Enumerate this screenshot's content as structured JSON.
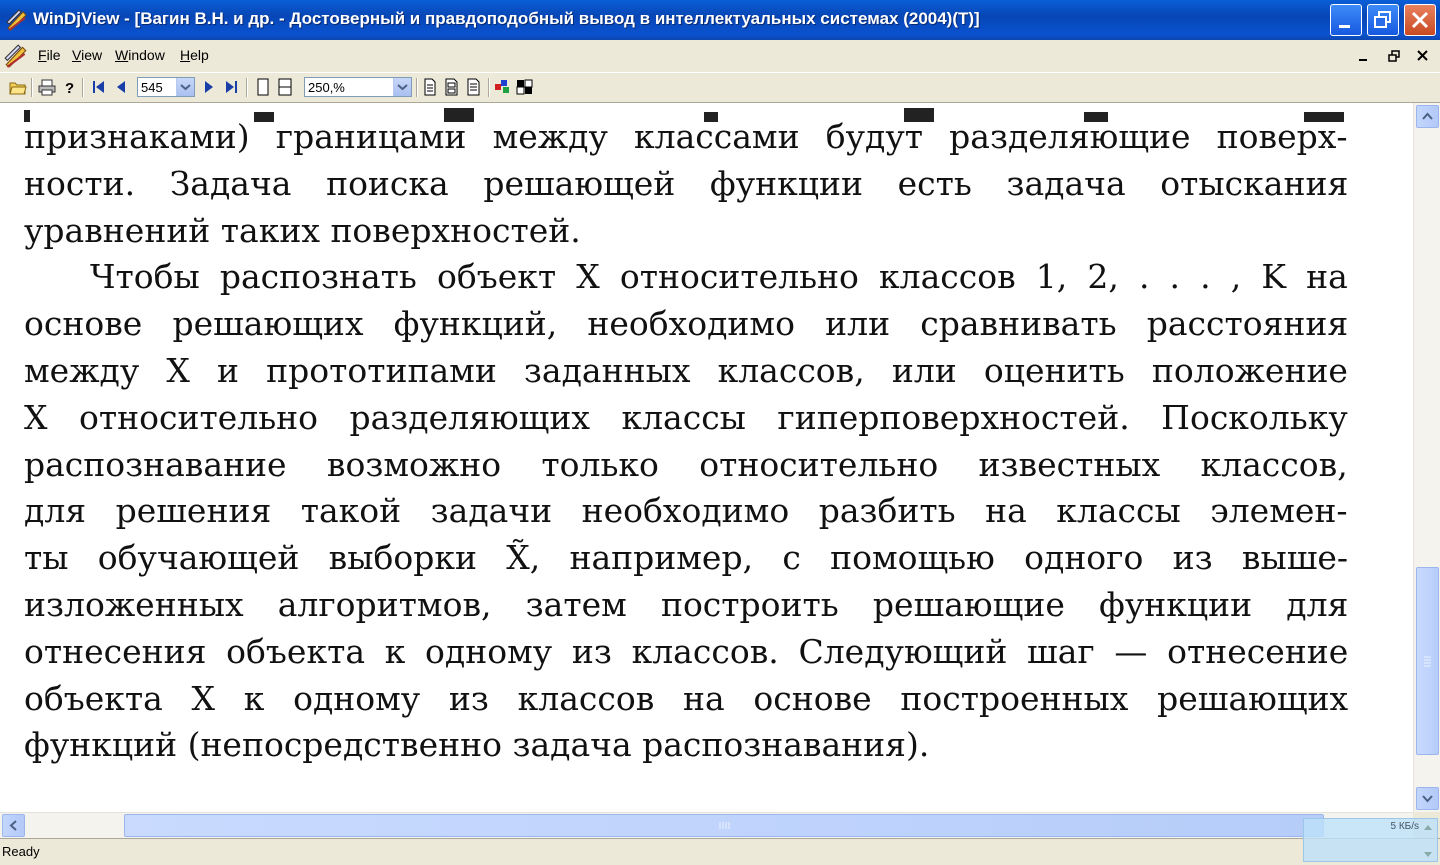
{
  "window": {
    "title": "WinDjView - [Вагин В.Н. и др. - Достоверный и правдоподобный вывод в интеллектуальных системах (2004)(Т)]"
  },
  "menu": {
    "items": [
      {
        "label": "File",
        "underline": "F",
        "rest": "ile"
      },
      {
        "label": "View",
        "underline": "V",
        "rest": "iew"
      },
      {
        "label": "Window",
        "underline": "W",
        "rest": "indow"
      },
      {
        "label": "Help",
        "underline": "H",
        "rest": "elp"
      }
    ]
  },
  "toolbar": {
    "page_number": "545",
    "zoom": "250,%"
  },
  "document": {
    "lines": [
      {
        "text": "признаками) границами между классами будут разделяющие поверх-",
        "indent": false
      },
      {
        "text": "ности. Задача поиска решающей функции есть задача отыскания",
        "indent": false
      },
      {
        "text": "уравнений таких поверхностей.",
        "indent": false,
        "ragged": true
      },
      {
        "text": "Чтобы распознать объект X относительно классов 1, 2, . . . , K на",
        "indent": true
      },
      {
        "text": "основе решающих функций, необходимо или сравнивать расстояния",
        "indent": false
      },
      {
        "text": "между X и прототипами заданных классов, или оценить положение",
        "indent": false
      },
      {
        "text": "X относительно разделяющих классы гиперповерхностей. Поскольку",
        "indent": false
      },
      {
        "text": "распознавание возможно только относительно известных классов,",
        "indent": false
      },
      {
        "text": "для решения такой задачи необходимо разбить на классы элемен-",
        "indent": false
      },
      {
        "text": "ты обучающей выборки X̃, например, с помощью одного из выше-",
        "indent": false
      },
      {
        "text": "изложенных алгоритмов, затем построить решающие функции для",
        "indent": false
      },
      {
        "text": "отнесения объекта к одному из классов. Следующий шаг — отнесение",
        "indent": false
      },
      {
        "text": "объекта X к одному из классов на основе построенных решающих",
        "indent": false
      },
      {
        "text": "функций (непосредственно задача распознавания).",
        "indent": false,
        "ragged": true
      }
    ]
  },
  "status": {
    "text": "Ready",
    "net_rate": "5 КБ/s"
  },
  "colors": {
    "titlebar": "#0a52cf",
    "chrome": "#ece9d8",
    "scroll_thumb": "#c9dafe"
  }
}
